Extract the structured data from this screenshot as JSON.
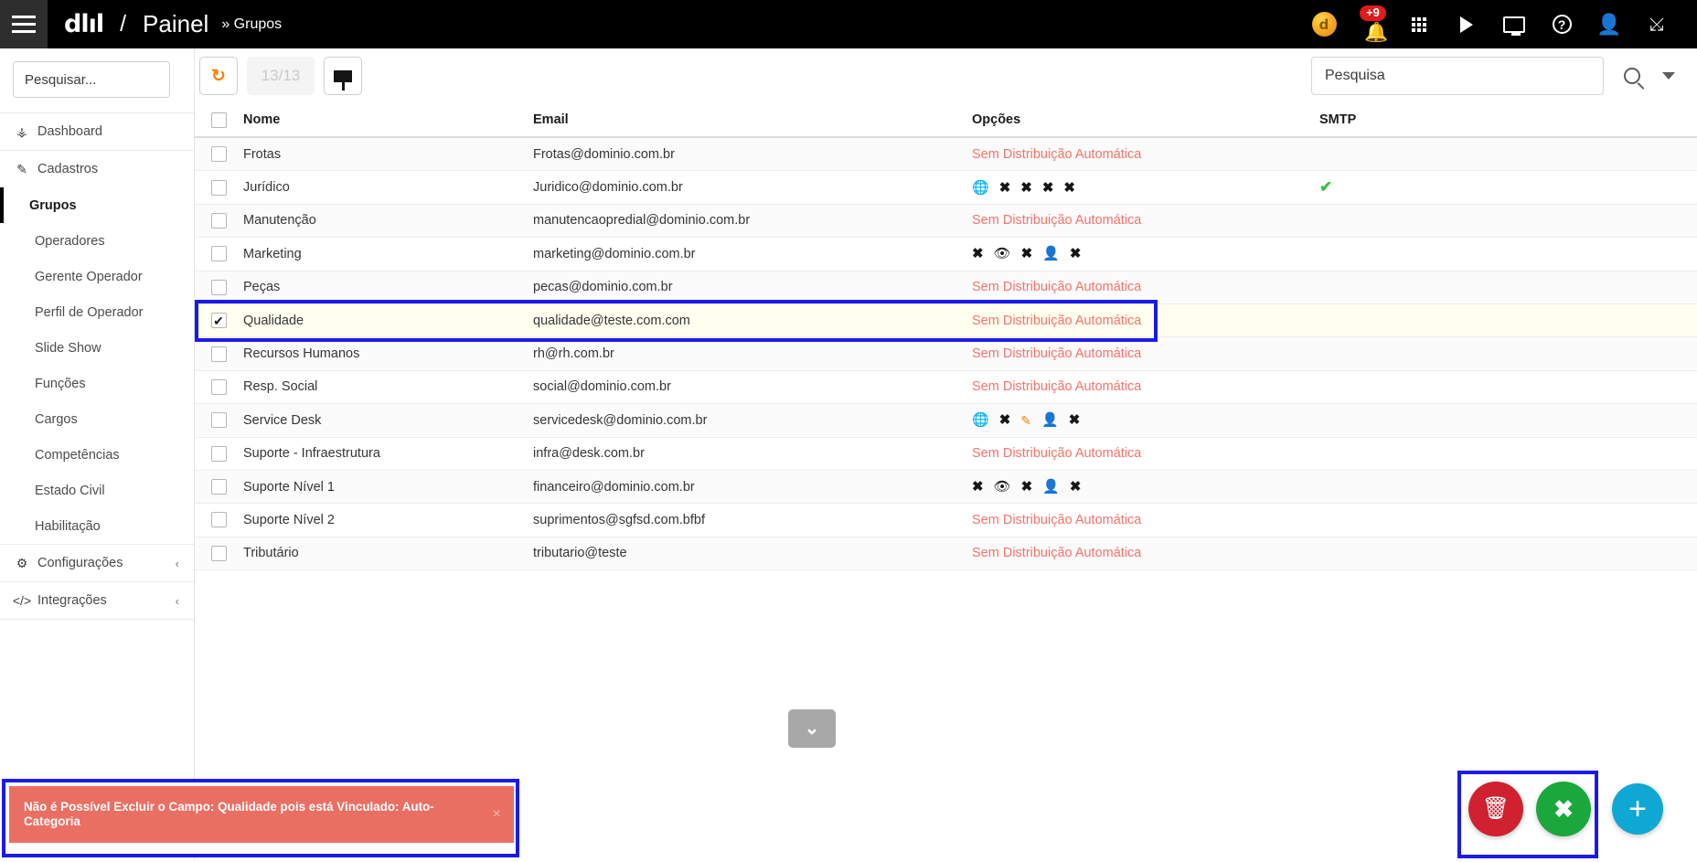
{
  "topbar": {
    "menu_icon": "hamburger-icon",
    "logo_text": "dlıl",
    "separator": "/",
    "title": "Painel",
    "breadcrumb": "» Grupos",
    "icons": [
      {
        "name": "coin-avatar",
        "glyph": "d"
      },
      {
        "name": "notifications-bell",
        "badge": "+9",
        "glyph": "🔔"
      },
      {
        "name": "apps-grid-icon"
      },
      {
        "name": "play-icon"
      },
      {
        "name": "monitor-icon"
      },
      {
        "name": "help-icon",
        "glyph": "?"
      },
      {
        "name": "user-icon",
        "glyph": "👤"
      },
      {
        "name": "fullscreen-icon",
        "glyph": "⤡"
      }
    ]
  },
  "sidebar": {
    "search_placeholder": "Pesquisar...",
    "search_value": "",
    "items": [
      {
        "label": "Dashboard",
        "icon": "dashboard-icon",
        "glyph": "⛁",
        "type": "item"
      },
      {
        "label": "Cadastros",
        "icon": "edit-icon",
        "glyph": "✎",
        "type": "item"
      },
      {
        "label": "Grupos",
        "type": "sub",
        "active": true
      },
      {
        "label": "Operadores",
        "type": "sub",
        "active": false
      },
      {
        "label": "Gerente Operador",
        "type": "sub",
        "active": false
      },
      {
        "label": "Perfil de Operador",
        "type": "sub",
        "active": false
      },
      {
        "label": "Slide Show",
        "type": "sub",
        "active": false
      },
      {
        "label": "Funções",
        "type": "sub",
        "active": false
      },
      {
        "label": "Cargos",
        "type": "sub",
        "active": false
      },
      {
        "label": "Competências",
        "type": "sub",
        "active": false
      },
      {
        "label": "Estado Civil",
        "type": "sub",
        "active": false
      },
      {
        "label": "Habilitação",
        "type": "sub",
        "active": false
      },
      {
        "label": "Configurações",
        "icon": "gear-icon",
        "glyph": "⚙",
        "type": "item",
        "chevron": "‹"
      },
      {
        "label": "Integrações",
        "icon": "code-icon",
        "glyph": "</>",
        "type": "item",
        "chevron": "‹"
      }
    ]
  },
  "toolbar": {
    "refresh_label": "↻",
    "counter": "13/13",
    "filter_label": "filter-icon",
    "search_placeholder": "Pesquisa",
    "search_value": ""
  },
  "table": {
    "columns": [
      "Nome",
      "Email",
      "Opções",
      "SMTP"
    ],
    "rows": [
      {
        "checked": false,
        "nome": "Frotas",
        "email": "Frotas@dominio.com.br",
        "opcoes_text": "Sem Distribuição Automática",
        "opcoes_icons": [],
        "smtp": ""
      },
      {
        "checked": false,
        "nome": "Jurídico",
        "email": "Juridico@dominio.com.br",
        "opcoes_text": "",
        "opcoes_icons": [
          "globe",
          "x",
          "x",
          "x",
          "x"
        ],
        "smtp": "✔"
      },
      {
        "checked": false,
        "nome": "Manutenção",
        "email": "manutencaopredial@dominio.com.br",
        "opcoes_text": "Sem Distribuição Automática",
        "opcoes_icons": [],
        "smtp": ""
      },
      {
        "checked": false,
        "nome": "Marketing",
        "email": "marketing@dominio.com.br",
        "opcoes_text": "",
        "opcoes_icons": [
          "x",
          "eye",
          "x",
          "person",
          "x"
        ],
        "smtp": ""
      },
      {
        "checked": false,
        "nome": "Peças",
        "email": "pecas@dominio.com.br",
        "opcoes_text": "Sem Distribuição Automática",
        "opcoes_icons": [],
        "smtp": ""
      },
      {
        "checked": true,
        "nome": "Qualidade",
        "email": "qualidade@teste.com.com",
        "opcoes_text": "Sem Distribuição Automática",
        "opcoes_icons": [],
        "smtp": "",
        "selected": true
      },
      {
        "checked": false,
        "nome": "Recursos Humanos",
        "email": "rh@rh.com.br",
        "opcoes_text": "Sem Distribuição Automática",
        "opcoes_icons": [],
        "smtp": ""
      },
      {
        "checked": false,
        "nome": "Resp. Social",
        "email": "social@dominio.com.br",
        "opcoes_text": "Sem Distribuição Automática",
        "opcoes_icons": [],
        "smtp": ""
      },
      {
        "checked": false,
        "nome": "Service Desk",
        "email": "servicedesk@dominio.com.br",
        "opcoes_text": "",
        "opcoes_icons": [
          "globe",
          "x",
          "pencil",
          "person",
          "x"
        ],
        "smtp": ""
      },
      {
        "checked": false,
        "nome": "Suporte - Infraestrutura",
        "email": "infra@desk.com.br",
        "opcoes_text": "Sem Distribuição Automática",
        "opcoes_icons": [],
        "smtp": ""
      },
      {
        "checked": false,
        "nome": "Suporte Nível 1",
        "email": "financeiro@dominio.com.br",
        "opcoes_text": "",
        "opcoes_icons": [
          "x",
          "eye",
          "x",
          "person",
          "x"
        ],
        "smtp": ""
      },
      {
        "checked": false,
        "nome": "Suporte Nível 2",
        "email": "suprimentos@sgfsd.com.bfbf",
        "opcoes_text": "Sem Distribuição Automática",
        "opcoes_icons": [],
        "smtp": ""
      },
      {
        "checked": false,
        "nome": "Tributário",
        "email": "tributario@teste",
        "opcoes_text": "Sem Distribuição Automática",
        "opcoes_icons": [],
        "smtp": ""
      }
    ]
  },
  "scroll_down": {
    "glyph": "⌄",
    "name": "scroll-down-button"
  },
  "toast": {
    "message": "Não é Possível Excluir o Campo: Qualidade pois está Vinculado: Auto-Categoria",
    "close": "×",
    "color": "#ea6f63"
  },
  "fabs": [
    {
      "name": "delete-fab",
      "glyph": "🗑",
      "color": "#cf2130"
    },
    {
      "name": "cancel-fab",
      "glyph": "✖",
      "color": "#1aa83c"
    },
    {
      "name": "add-fab",
      "glyph": "+",
      "color": "#0fa8d4"
    }
  ],
  "highlight_color": "#1a1ae8"
}
